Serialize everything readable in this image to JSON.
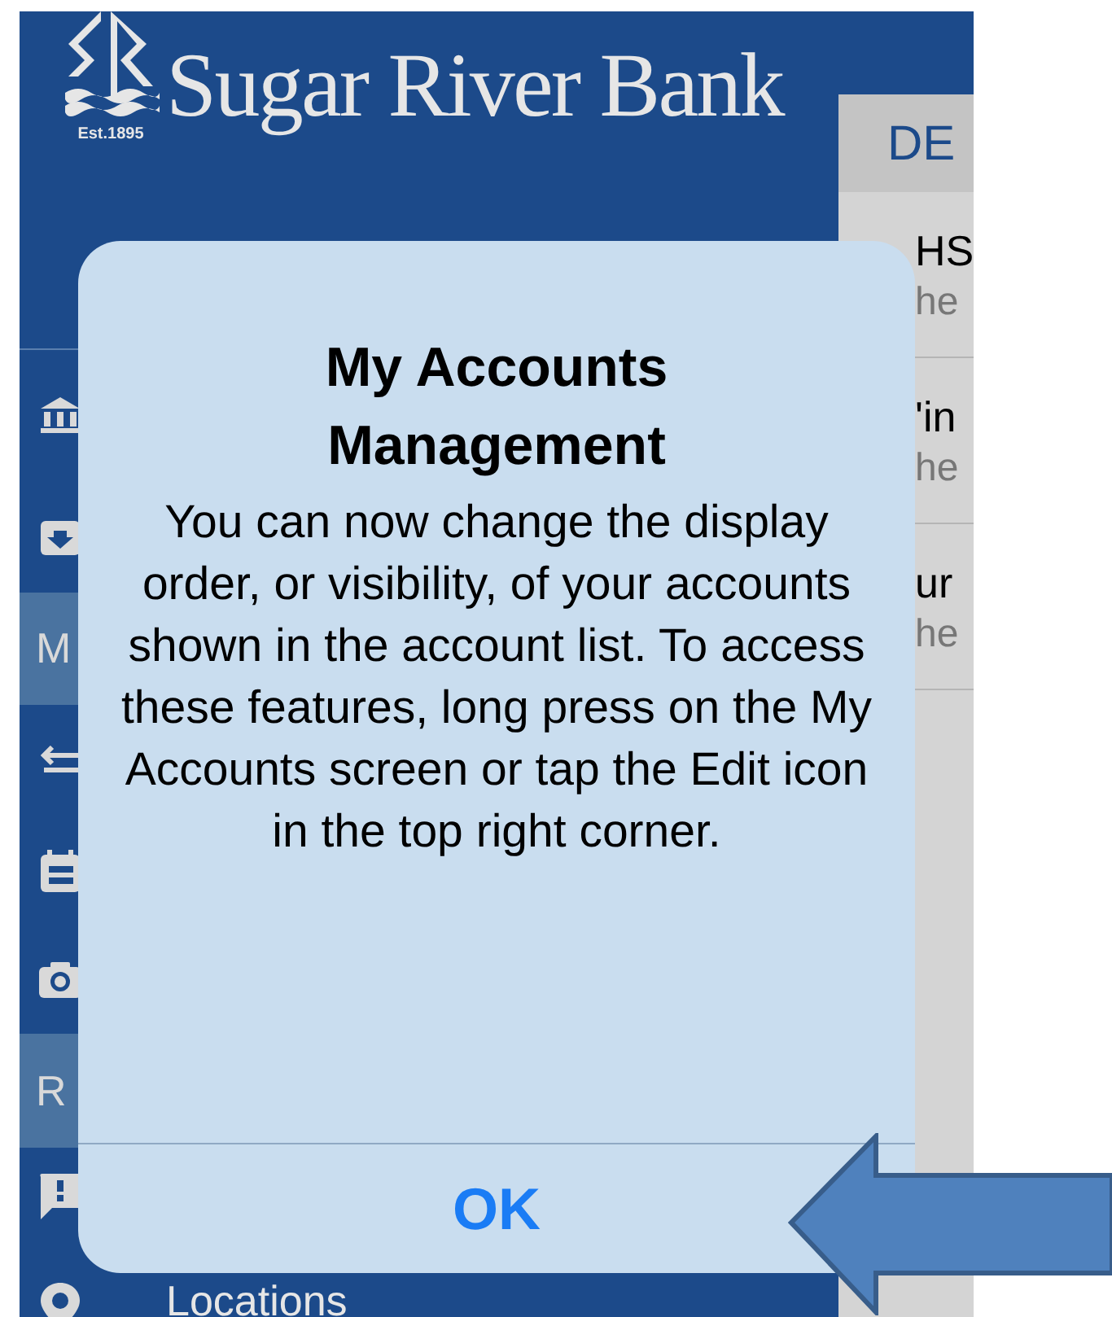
{
  "header": {
    "logo_text": "Sugar River Bank",
    "established": "Est.1895"
  },
  "sidebar": {
    "items": [
      {
        "kind": "link"
      },
      {
        "kind": "link"
      },
      {
        "kind": "section",
        "label": "M"
      },
      {
        "kind": "link"
      },
      {
        "kind": "link"
      },
      {
        "kind": "link"
      },
      {
        "kind": "section",
        "label": "R"
      },
      {
        "kind": "link"
      },
      {
        "kind": "link",
        "label": "Locations"
      }
    ]
  },
  "accounts_panel": {
    "heading": "DE",
    "rows": [
      {
        "name": "HS",
        "detail": "he"
      },
      {
        "name": "'in",
        "detail": "he"
      },
      {
        "name": "ur",
        "detail": "he"
      }
    ]
  },
  "alert": {
    "title": "My Accounts Management",
    "message": "You can now change the display order, or visibility, of your accounts shown in the account list. To access these features, long press on the My Accounts screen or tap the Edit icon in the top right corner.",
    "button": "OK"
  }
}
